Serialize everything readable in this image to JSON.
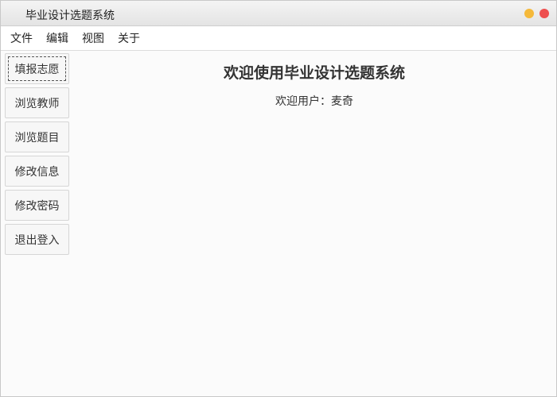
{
  "window": {
    "title": "毕业设计选题系统",
    "controls": {
      "minimize_color": "#f5b93a",
      "close_color": "#ee4f4f"
    }
  },
  "menubar": {
    "items": [
      "文件",
      "编辑",
      "视图",
      "关于"
    ]
  },
  "sidebar": {
    "buttons": [
      "填报志愿",
      "浏览教师",
      "浏览题目",
      "修改信息",
      "修改密码",
      "退出登入"
    ]
  },
  "main": {
    "title": "欢迎使用毕业设计选题系统",
    "user_label": "欢迎用户：",
    "user_name": "麦奇"
  }
}
